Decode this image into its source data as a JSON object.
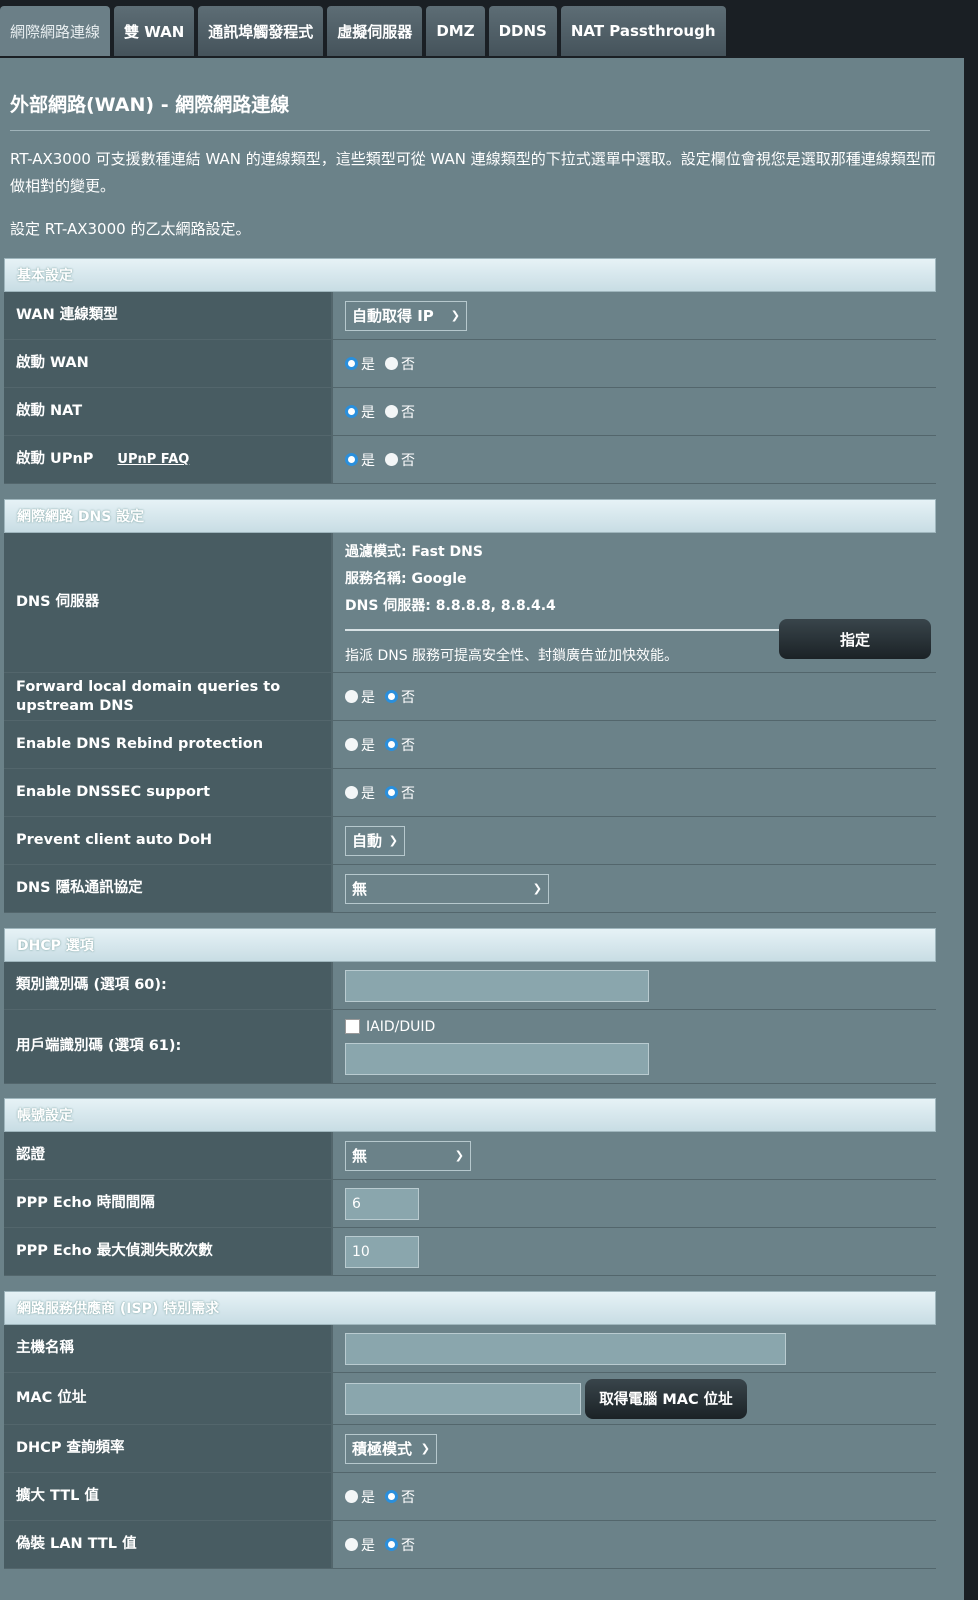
{
  "tabs": [
    "網際網路連線",
    "雙 WAN",
    "通訊埠觸發程式",
    "虛擬伺服器",
    "DMZ",
    "DDNS",
    "NAT Passthrough"
  ],
  "page": {
    "title": "外部網路(WAN) - 網際網路連線",
    "desc1": "RT-AX3000 可支援數種連結 WAN 的連線類型，這些類型可從 WAN 連線類型的下拉式選單中選取。設定欄位會視您是選取那種連線類型而做相對的變更。",
    "desc2": "設定 RT-AX3000 的乙太網路設定。"
  },
  "opts": {
    "yes": "是",
    "no": "否"
  },
  "basic": {
    "header": "基本設定",
    "wan_type_label": "WAN 連線類型",
    "wan_type_value": "自動取得 IP",
    "enable_wan": "啟動 WAN",
    "enable_nat": "啟動 NAT",
    "enable_upnp": "啟動 UPnP",
    "upnp_faq": "UPnP FAQ"
  },
  "dns": {
    "header": "網際網路 DNS 設定",
    "server_label": "DNS 伺服器",
    "filter_mode": "過濾模式: Fast DNS",
    "service_name": "服務名稱: Google",
    "dns_servers": "DNS 伺服器: 8.8.8.8, 8.8.4.4",
    "note": "指派 DNS 服務可提高安全性、封鎖廣告並加快效能。",
    "assign_button": "指定",
    "forward_label": "Forward local domain queries to upstream DNS",
    "rebind_label": "Enable DNS Rebind protection",
    "dnssec_label": "Enable DNSSEC support",
    "doh_label": "Prevent client auto DoH",
    "doh_value": "自動",
    "privacy_label": "DNS 隱私通訊協定",
    "privacy_value": "無"
  },
  "dhcp": {
    "header": "DHCP 選項",
    "class_label": "類別識別碼 (選項 60):",
    "client_label": "用戶端識別碼 (選項 61):",
    "iaid": "IAID/DUID"
  },
  "account": {
    "header": "帳號設定",
    "auth_label": "認證",
    "auth_value": "無",
    "echo_interval_label": "PPP Echo 時間間隔",
    "echo_interval_value": "6",
    "echo_fail_label": "PPP Echo 最大偵測失敗次數",
    "echo_fail_value": "10"
  },
  "isp": {
    "header": "網路服務供應商 (ISP) 特別需求",
    "host_label": "主機名稱",
    "mac_label": "MAC 位址",
    "mac_button": "取得電腦 MAC 位址",
    "dhcp_freq_label": "DHCP 查詢頻率",
    "dhcp_freq_value": "積極模式",
    "ttl_label": "擴大 TTL 值",
    "lan_ttl_label": "偽裝 LAN TTL 值"
  }
}
